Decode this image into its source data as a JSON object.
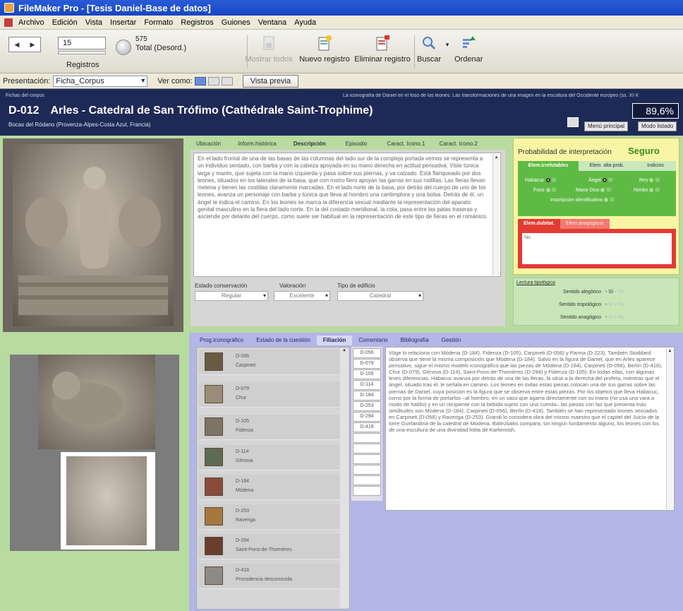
{
  "window": {
    "title": "FileMaker Pro - [Tesis Daniel-Base de datos]"
  },
  "menu": [
    "Archivo",
    "Edición",
    "Vista",
    "Insertar",
    "Formato",
    "Registros",
    "Guiones",
    "Ventana",
    "Ayuda"
  ],
  "toolbar": {
    "record_number": "15",
    "records_label": "Registros",
    "total_count": "575",
    "total_label": "Total (Desord.)",
    "show_all": "Mostrar todos",
    "new_record": "Nuevo registro",
    "delete_record": "Eliminar registro",
    "find": "Buscar",
    "sort": "Ordenar"
  },
  "layoutbar": {
    "label": "Presentación:",
    "layout": "Ficha_Corpus",
    "view_as": "Ver como:",
    "preview": "Vista previa"
  },
  "header": {
    "small_label": "Fichas del corpus",
    "subtitle": "La iconografía de Daniel en el foso de los leones. Las transformaciones de una imagen en la escultura del Occidente europeo (ss. XI-X",
    "code": "D-012",
    "title": "Arles - Catedral de San Trófimo (Cathédrale Saint-Trophime)",
    "location": "Bocas del Ródano (Provenza-Alpes-Costa Azul, Francia)",
    "percent": "89,6%",
    "btn_main_menu": "Menú principal",
    "btn_list_mode": "Modo listado"
  },
  "top_tabs": [
    "Ubicación",
    "Inform.histórica",
    "Descripción",
    "Episodio",
    "Caract. Icono.1",
    "Caract. Icono.2"
  ],
  "top_active_tab": "Descripción",
  "description": "En el lado frontal de una de las basas de las columnas del lado sur de la compleja portada vemos se representa a un individuo sentado, con barba y con la cabeza apoyada en su mano derecha en actitud pensativa. Viste túnica larga y manto, que sujeta con la mano izquierda y pasa sobre sus piernas, y va calzado. Está flanqueado por dos leones, situados en los laterales de la basa, que con rostro fiero apoyan las garras en sus rodillas. Las fieras llevan melena y tienen las costillas claramente marcadas. En el lado norte de la basa, por detrás del cuerpo de uno de los leones, avanza un personaje con barba y túnica que lleva al hombro una cantimplora y una bolsa. Detrás de él, un ángel le indica el camino. En los leones se marca la diferencia sexual mediante la representación del aparato genital masculino en la fiera del lado norte. En la del costado meridional, la cola, pasa entre las patas traseras y asciende por delante del cuerpo, como suele ser habitual en la representación de este tipo de fieras en el románico.",
  "fields": {
    "conservation_label": "Estado conservación",
    "conservation": "Regular",
    "valuation_label": "Valoración",
    "valuation": "Excelente",
    "building_label": "Tipo de edificio",
    "building": "Catedral"
  },
  "probability": {
    "label": "Probabilidad de interpretación",
    "value": "Seguro",
    "tabs": [
      "Elem.irrefutables",
      "Elem. alta prob.",
      "Indicios"
    ],
    "items": {
      "habacuc": "Habacuc",
      "angel": "Ángel",
      "rey": "Rey",
      "foso": "Foso",
      "mano_dios": "Mano Dios",
      "nimbo": "Nimbo",
      "inscripcion": "Inscripción identificativa",
      "si": "Sí"
    },
    "red_tabs": [
      "Elem.dubitat.",
      "Elem.anagógicos"
    ],
    "red_value": "No"
  },
  "typology": {
    "label": "Lectura tipológica",
    "rows": [
      "Sentido alegórico",
      "Sentido tropológico",
      "Sentido anagógico"
    ],
    "si": "Sí",
    "no": "No"
  },
  "bottom_tabs": [
    "Prog.iconográfico",
    "Estado de la cuestión",
    "Filiación",
    "Comentario",
    "Bibliografía",
    "Gestión"
  ],
  "bottom_active_tab": "Filiación",
  "filiation": [
    {
      "code": "D-056",
      "name": "Carpineti"
    },
    {
      "code": "D-079",
      "name": "Chur"
    },
    {
      "code": "D-105",
      "name": "Fidenza"
    },
    {
      "code": "D-114",
      "name": "Génova"
    },
    {
      "code": "D-184",
      "name": "Módena"
    },
    {
      "code": "D-253",
      "name": "Ravenga"
    },
    {
      "code": "D-294",
      "name": "Saint-Pons-de-Thomières"
    },
    {
      "code": "D-418",
      "name": "Procedencia desconocida"
    }
  ],
  "related_codes": [
    "D-056",
    "D-079",
    "D-105",
    "D-114",
    "D-184",
    "D-253",
    "D-294",
    "D-418"
  ],
  "filiation_text": "Vöge lo relaciona con Módena (D-184), Fidenza (D-105), Carpineti (D-056) y Parma (D-223). También Stoddard observa que tiene la misma composición que Módena (D-184). Salvo en la figura de Daniel, que en Arles aparece pensativo, sigue el mismo modelo iconográfico que las piezas de Módena (D-184), Carpineti (D-056), Berlín (D-418), Chur (D-079), Génova (D-114), Saint-Pons-de-Thomières (D-294) y Fidenza (D-105). En todas ellas, con algunas leves diferencias, Habacuc avanza por detrás de una de las fieras, la sitúa a la derecha del profeta, mientras que el ángel, situado tras él, le señala en camino. Los leones en todas estas piezas colocan una de sus garras sobre las piernas de Daniel, cuya posición es la figura que se observa entre estas piezas. Por los objetos que lleva Habacuc, como por la forma de portarlos –al hombro, en un saco que agarra directamente con su mano (no usa una vara a modo de hatillo) y en un recipiente con la bebida sujeto con una cuerda– las piezas con las que presenta más similitudes son Módena (D-184), Carpineti (D-056), Berlín (D-418). También se han representado leones sexuados en Carpineti (D-056) y Ravenga (D-253). Grandi lo considera obra del mismo maestro que el capitel del Juicio de la torre Guirlandina de la catedral de Módena. Baltrušaitis compara, sin ningún fundamento alguno, los leones con los de una escultura de una divinidad hitita de Karkemish."
}
